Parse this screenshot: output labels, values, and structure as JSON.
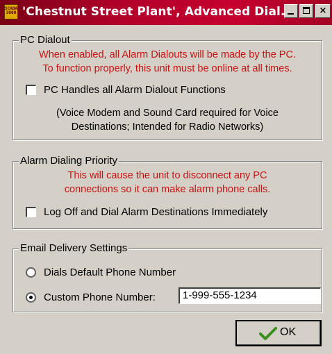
{
  "window": {
    "title": "'Chestnut Street Plant', Advanced Dial...",
    "icon_text": "SCADA 3000",
    "controls": {
      "minimize": "minimize-icon",
      "maximize": "maximize-icon",
      "close": "×"
    }
  },
  "pc_dialout": {
    "legend": "PC Dialout",
    "warning_line1": "When enabled, all Alarm Dialouts will be made by the PC.",
    "warning_line2": "To function properly, this unit must be online at all times.",
    "checkbox_label": "PC Handles all Alarm Dialout Functions",
    "checked": false,
    "note_line1": "(Voice Modem and Sound Card required for Voice",
    "note_line2": "Destinations; Intended for Radio Networks)"
  },
  "alarm_priority": {
    "legend": "Alarm Dialing Priority",
    "warning_line1": "This will cause the unit to disconnect any PC",
    "warning_line2": "connections so it can make alarm phone calls.",
    "checkbox_label": "Log Off and Dial Alarm Destinations Immediately",
    "checked": false
  },
  "email_delivery": {
    "legend": "Email Delivery Settings",
    "option_default_label": "Dials Default Phone Number",
    "option_custom_label": "Custom Phone Number:",
    "selected": "custom",
    "phone_value": "1-999-555-1234"
  },
  "ok_button": {
    "label": "OK",
    "icon": "checkmark-icon"
  },
  "colors": {
    "warning_text": "#cc1111",
    "titlebar": "#b0002a",
    "face": "#d4d0c8"
  }
}
